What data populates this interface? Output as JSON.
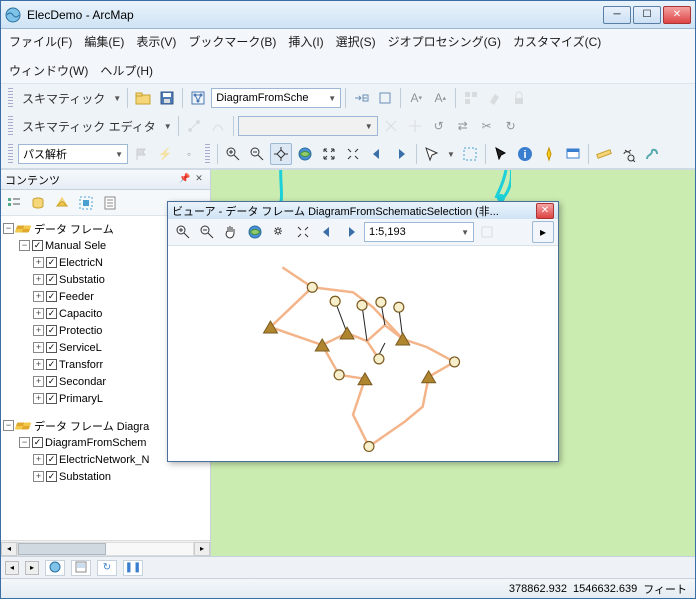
{
  "window": {
    "title": "ElecDemo - ArcMap"
  },
  "menu": {
    "file": "ファイル(F)",
    "edit": "編集(E)",
    "view": "表示(V)",
    "bookmarks": "ブックマーク(B)",
    "insert": "挿入(I)",
    "selection": "選択(S)",
    "geoprocessing": "ジオプロセシング(G)",
    "customize": "カスタマイズ(C)",
    "window": "ウィンドウ(W)",
    "help": "ヘルプ(H)"
  },
  "toolbar1": {
    "schematic_label": "スキマティック",
    "diagram_combo": "DiagramFromSche"
  },
  "toolbar2": {
    "editor_label": "スキマティック エディタ",
    "combo_empty": ""
  },
  "toolbar3": {
    "analysis_combo": "パス解析"
  },
  "toc": {
    "title": "コンテンツ",
    "df1": "データ フレーム",
    "ms": "Manual Sele",
    "layers1": [
      "ElectricN",
      "Substatio",
      "Feeder",
      "Capacito",
      "Protectio",
      "ServiceL",
      "Transforr",
      "Secondar",
      "PrimaryL"
    ],
    "df2": "データ フレーム Diagra",
    "dfs": "DiagramFromSchem",
    "layers2": [
      "ElectricNetwork_N",
      "Substation"
    ]
  },
  "viewer": {
    "title": "ビューア - データ フレーム DiagramFromSchematicSelection (非...",
    "scale": "1:5,193"
  },
  "status": {
    "x": "378862.932",
    "y": "1546632.639",
    "units": "フィート"
  },
  "colors": {
    "map_bg": "#cbecb0",
    "network_line": "#f3b48a",
    "node_fill": "#f7eecb",
    "tri_fill": "#b08530"
  }
}
